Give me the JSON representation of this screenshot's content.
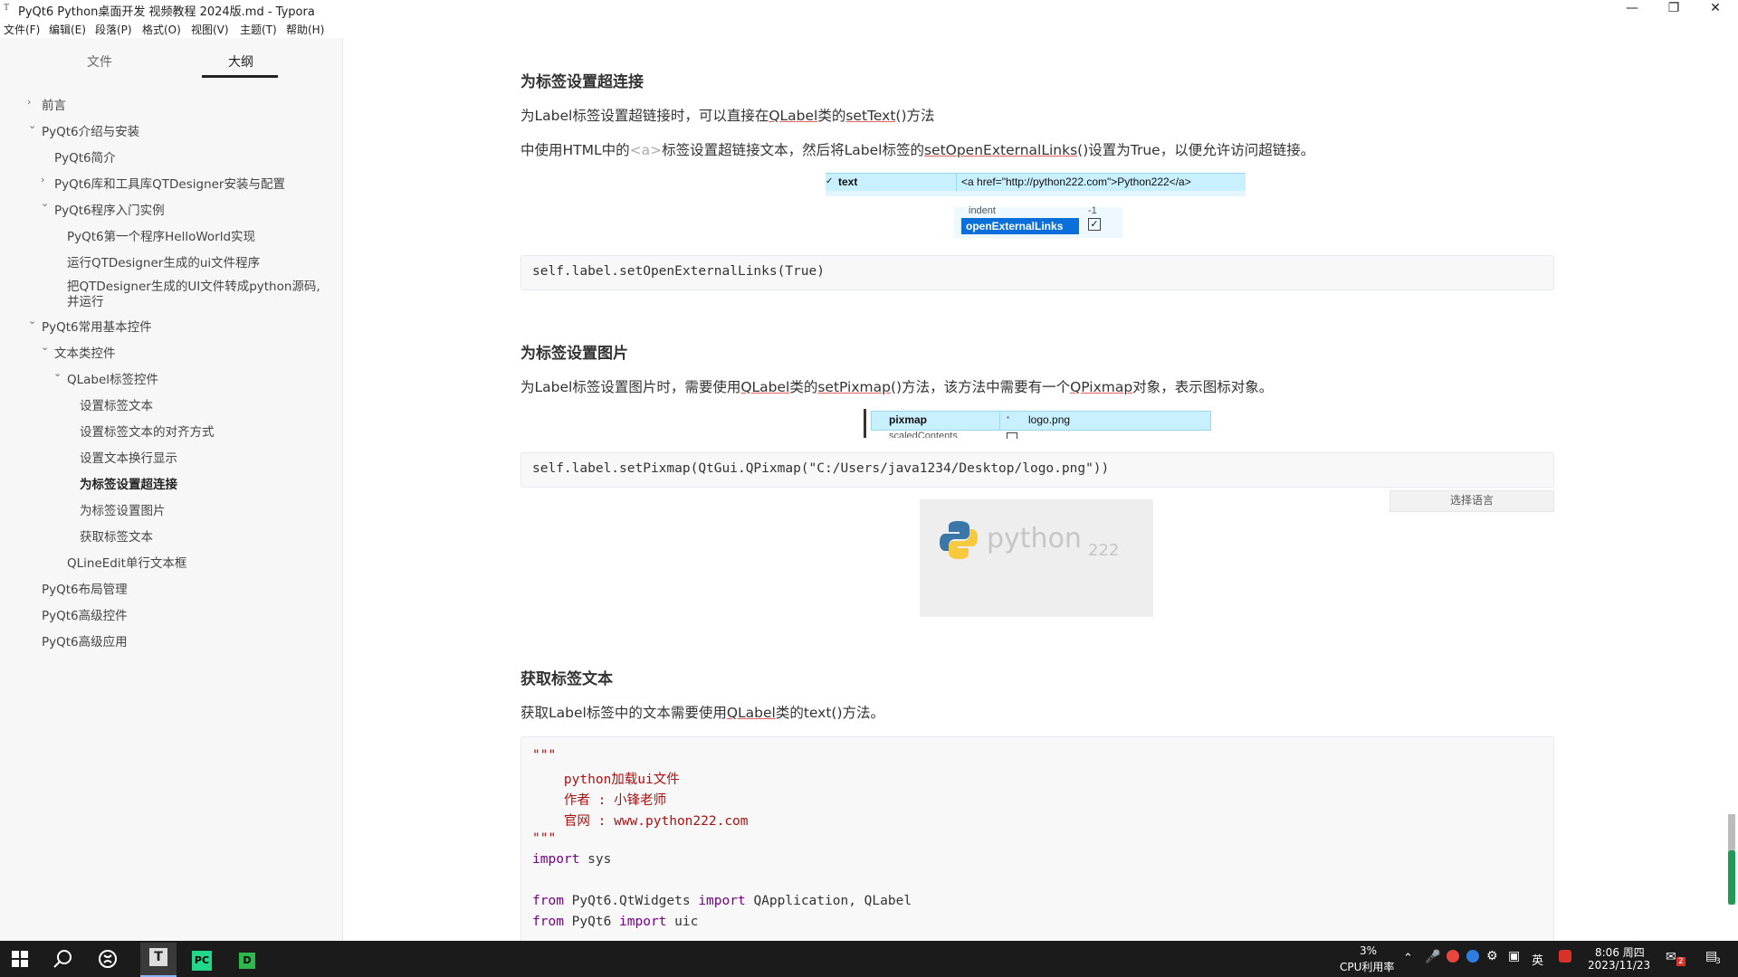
{
  "window": {
    "title": "PyQt6 Python桌面开发 视频教程 2024版.md - Typora",
    "title_icon": "T"
  },
  "menu": [
    "文件(F)",
    "编辑(E)",
    "段落(P)",
    "格式(O)",
    "视图(V)",
    "主题(T)",
    "帮助(H)"
  ],
  "sidebar": {
    "tabs": [
      "文件",
      "大纲"
    ],
    "active_tab": "大纲",
    "items": [
      {
        "label": "前言",
        "chev": "›"
      },
      {
        "label": "PyQt6介绍与安装",
        "chev": "⌄"
      },
      {
        "label": "PyQt6简介",
        "chev": ""
      },
      {
        "label": "PyQt6库和工具库QTDesigner安装与配置",
        "chev": "›"
      },
      {
        "label": "PyQt6程序入门实例",
        "chev": "⌄"
      },
      {
        "label": "PyQt6第一个程序HelloWorld实现",
        "chev": ""
      },
      {
        "label": "运行QTDesigner生成的ui文件程序",
        "chev": ""
      },
      {
        "label": "把QTDesigner生成的UI文件转成python源码,",
        "chev": ""
      },
      {
        "label": "并运行",
        "chev": ""
      },
      {
        "label": "PyQt6常用基本控件",
        "chev": "⌄"
      },
      {
        "label": "文本类控件",
        "chev": "⌄"
      },
      {
        "label": "QLabel标签控件",
        "chev": "⌄"
      },
      {
        "label": "设置标签文本",
        "chev": ""
      },
      {
        "label": "设置标签文本的对齐方式",
        "chev": ""
      },
      {
        "label": "设置文本换行显示",
        "chev": ""
      },
      {
        "label": "为标签设置超连接",
        "chev": ""
      },
      {
        "label": "为标签设置图片",
        "chev": ""
      },
      {
        "label": "获取标签文本",
        "chev": ""
      },
      {
        "label": "QLineEdit单行文本框",
        "chev": ""
      },
      {
        "label": "PyQt6布局管理",
        "chev": ""
      },
      {
        "label": "PyQt6高级控件",
        "chev": ""
      },
      {
        "label": "PyQt6高级应用",
        "chev": ""
      }
    ]
  },
  "content": {
    "section1": {
      "heading": "为标签设置超连接",
      "p1_a": "为Label标签设置超链接时，可以直接在",
      "p1_b": "QLabel",
      "p1_c": "类的",
      "p1_d": "setText",
      "p1_e": "()方法",
      "p2_a": "中使用HTML中的",
      "p2_b": "<a>",
      "p2_c": "标签设置超链接文本，然后将Label标签的",
      "p2_d": "setOpenExternalLinks",
      "p2_e": "()设置为True，以便允许访问超链接。",
      "prop_text_name": "text",
      "prop_text_value": "<a href=\"http://python222.com\">Python222</a>",
      "prop_indent": "indent",
      "prop_indent_val": "-1",
      "prop_links": "openExternalLinks",
      "code": "self.label.setOpenExternalLinks(True)"
    },
    "section2": {
      "heading": "为标签设置图片",
      "p_a": "为Label标签设置图片时，需要使用",
      "p_b": "QLabel",
      "p_c": "类的",
      "p_d": "setPixmap",
      "p_e": "()方法，该方法中需要有一个",
      "p_f": "QPixmap",
      "p_g": "对象，表示图标对象。",
      "prop_pixmap": "pixmap",
      "prop_pixmap_val": "logo.png",
      "prop_scaled": "scaledContents",
      "code": "self.label.setPixmap(QtGui.QPixmap(\"C:/Users/java1234/Desktop/logo.png\"))",
      "lang_button": "选择语言",
      "logo_text": "python",
      "logo_num": "222"
    },
    "section3": {
      "heading": "获取标签文本",
      "p_a": "获取Label标签中的文本需要使用",
      "p_b": "QLabel",
      "p_c": "类的text()方法。",
      "code_lines": {
        "l1": "\"\"\"",
        "l2": "    python加载ui文件",
        "l3": "    作者 : 小锋老师",
        "l4": "    官网 : www.python222.com",
        "l5": "\"\"\"",
        "l6_kw": "import",
        "l6_rest": " sys",
        "l7_kw1": "from",
        "l7_mod": " PyQt6.QtWidgets ",
        "l7_kw2": "import",
        "l7_rest": " QApplication, QLabel",
        "l8_kw1": "from",
        "l8_mod": " PyQt6 ",
        "l8_kw2": "import",
        "l8_rest": " uic"
      }
    }
  },
  "taskbar": {
    "cpu_pct": "3%",
    "cpu_label": "CPU利用率",
    "ime": "英",
    "time": "8:06 周四",
    "date": "2023/11/23",
    "badge": "2",
    "notify": "3"
  },
  "colors": {
    "sidebar_bg": "#f7f7f7",
    "code_bg": "#f8f8f8",
    "keyword": "#770088",
    "string": "#aa1111",
    "taskbar_bg": "#1b1b1b",
    "prop_highlight": "#c9f0ff",
    "prop_select": "#0a6fd8"
  }
}
